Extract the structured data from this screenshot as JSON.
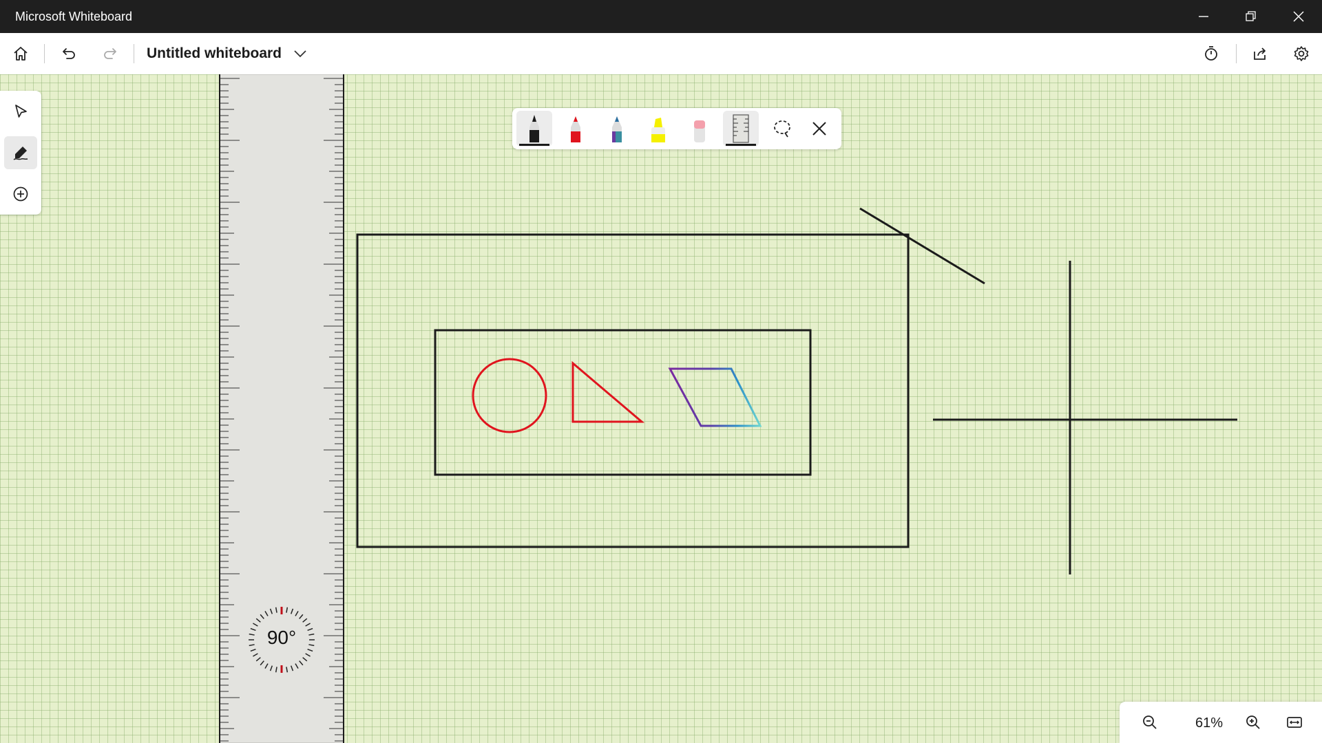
{
  "window": {
    "app_title": "Microsoft Whiteboard",
    "controls": [
      "minimize",
      "restore",
      "close"
    ]
  },
  "toolbar": {
    "board_title": "Untitled whiteboard",
    "icons": [
      "home-icon",
      "undo-icon",
      "redo-icon",
      "chevron-down-icon",
      "timer-icon",
      "share-icon",
      "settings-icon"
    ]
  },
  "left_rail": {
    "items": [
      {
        "name": "select",
        "icon": "pointer-icon",
        "active": false
      },
      {
        "name": "ink",
        "icon": "pen-icon",
        "active": true
      },
      {
        "name": "create",
        "icon": "plus-circle-icon",
        "active": false
      }
    ]
  },
  "ink_toolbar": {
    "tools": [
      {
        "name": "black-pen",
        "color": "#1b1b1b",
        "selected": true
      },
      {
        "name": "red-pen",
        "color": "#e0141e",
        "selected": false
      },
      {
        "name": "galaxy-pen",
        "color": "#3a8fa0",
        "selected": false
      },
      {
        "name": "highlighter",
        "color": "#f5f000",
        "selected": false
      },
      {
        "name": "eraser",
        "color": "#f4a0ac",
        "selected": false
      },
      {
        "name": "ruler",
        "selected": true
      },
      {
        "name": "lasso",
        "selected": false
      },
      {
        "name": "close",
        "selected": false
      }
    ]
  },
  "ruler": {
    "angle_label": "90°"
  },
  "canvas": {
    "background_color": "#e6f0cc",
    "ink_colors": {
      "black": "#1b1b1b",
      "red": "#e0141e"
    }
  },
  "zoom": {
    "level": "61%"
  }
}
